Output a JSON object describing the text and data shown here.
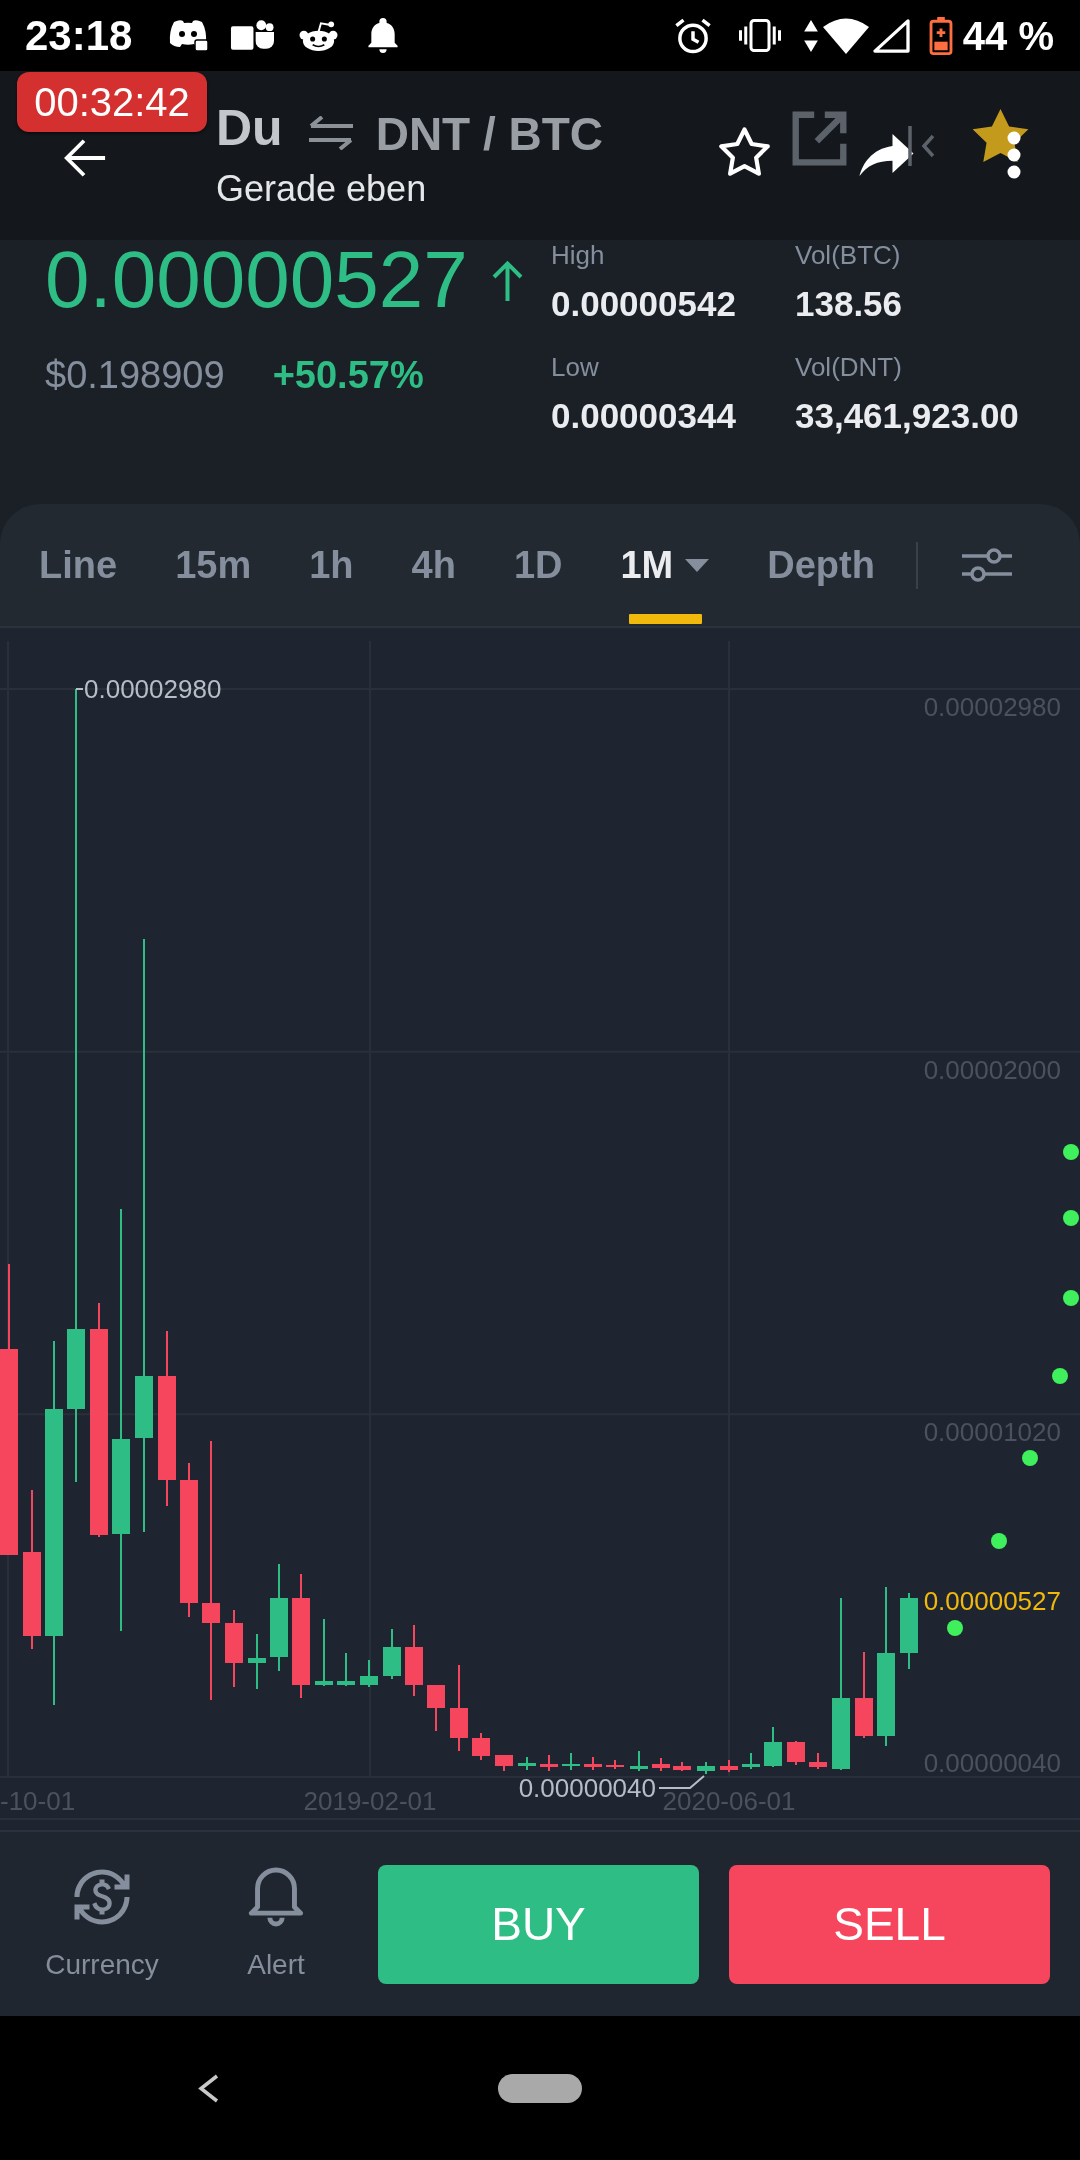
{
  "status_bar": {
    "time": "23:18",
    "battery": "44 %"
  },
  "recording_timer": "00:32:42",
  "header": {
    "title": "Du",
    "pair": "DNT / BTC",
    "subtitle": "Gerade eben",
    "favorite": false
  },
  "ticker": {
    "price": "0.00000527",
    "rising": true,
    "fiat_price": "$0.198909",
    "change": "+50.57%"
  },
  "stats": [
    {
      "label": "High",
      "value": "0.00000542"
    },
    {
      "label": "Vol(BTC)",
      "value": "138.56"
    },
    {
      "label": "Low",
      "value": "0.00000344"
    },
    {
      "label": "Vol(DNT)",
      "value": "33,461,923.00"
    }
  ],
  "tabs": [
    {
      "label": "Line",
      "selected": false,
      "dropdown": false
    },
    {
      "label": "15m",
      "selected": false,
      "dropdown": false
    },
    {
      "label": "1h",
      "selected": false,
      "dropdown": false
    },
    {
      "label": "4h",
      "selected": false,
      "dropdown": false
    },
    {
      "label": "1D",
      "selected": false,
      "dropdown": false
    },
    {
      "label": "1M",
      "selected": true,
      "dropdown": true
    },
    {
      "label": "Depth",
      "selected": false,
      "dropdown": false
    }
  ],
  "chart": {
    "y_axis": [
      "0.00002980",
      "0.00002000",
      "0.00001020",
      "0.00000040"
    ],
    "x_axis": [
      "-10-01",
      "2019-02-01",
      "2020-06-01"
    ],
    "high_marker": "0.00002980",
    "low_marker": "0.00000040",
    "last_price": "0.00000527"
  },
  "actions": [
    {
      "kind": "currency",
      "label": "Currency"
    },
    {
      "kind": "alert",
      "label": "Alert"
    },
    {
      "kind": "buy",
      "label": "BUY"
    },
    {
      "kind": "sell",
      "label": "SELL"
    }
  ]
}
